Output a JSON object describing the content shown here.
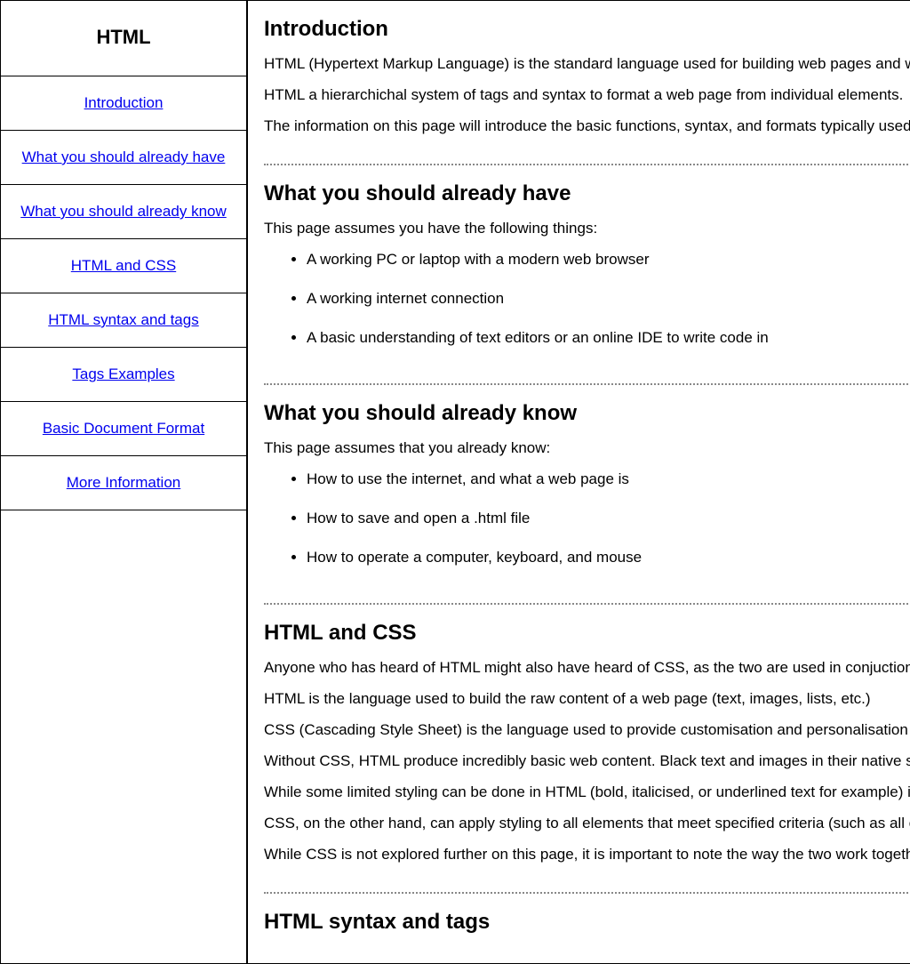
{
  "nav": {
    "title": "HTML",
    "items": [
      {
        "label": "Introduction"
      },
      {
        "label": "What you should already have"
      },
      {
        "label": "What you should already know"
      },
      {
        "label": "HTML and CSS"
      },
      {
        "label": "HTML syntax and tags"
      },
      {
        "label": "Tags Examples"
      },
      {
        "label": "Basic Document Format"
      },
      {
        "label": "More Information"
      }
    ]
  },
  "sections": {
    "intro": {
      "heading": "Introduction",
      "p1": "HTML (Hypertext Markup Language) is the standard language used for building web pages and websites.",
      "p2": "HTML a hierarchichal system of tags and syntax to format a web page from individual elements.",
      "p3": "The information on this page will introduce the basic functions, syntax, and formats typically used in HTML."
    },
    "have": {
      "heading": "What you should already have",
      "intro": "This page assumes you have the following things:",
      "li1": "A working PC or laptop with a modern web browser",
      "li2": "A working internet connection",
      "li3": "A basic understanding of text editors or an online IDE to write code in"
    },
    "know": {
      "heading": "What you should already know",
      "intro": "This page assumes that you already know:",
      "li1": "How to use the internet, and what a web page is",
      "li2": "How to save and open a .html file",
      "li3": "How to operate a computer, keyboard, and mouse"
    },
    "css": {
      "heading": "HTML and CSS",
      "p1": "Anyone who has heard of HTML might also have heard of CSS, as the two are used in conjuction.",
      "p2": "HTML is the language used to build the raw content of a web page (text, images, lists, etc.)",
      "p3": "CSS (Cascading Style Sheet) is the language used to provide customisation and personalisation to the content.",
      "p4": "Without CSS, HTML produce incredibly basic web content. Black text and images in their native sizes.",
      "p5": "While some limited styling can be done in HTML (bold, italicised, or underlined text for example) it is very limited.",
      "p6": "CSS, on the other hand, can apply styling to all elements that meet specified criteria (such as all content in a list).",
      "p7": "While CSS is not explored further on this page, it is important to note the way the two work together. They are separate languages."
    },
    "syntax": {
      "heading": "HTML syntax and tags"
    }
  }
}
